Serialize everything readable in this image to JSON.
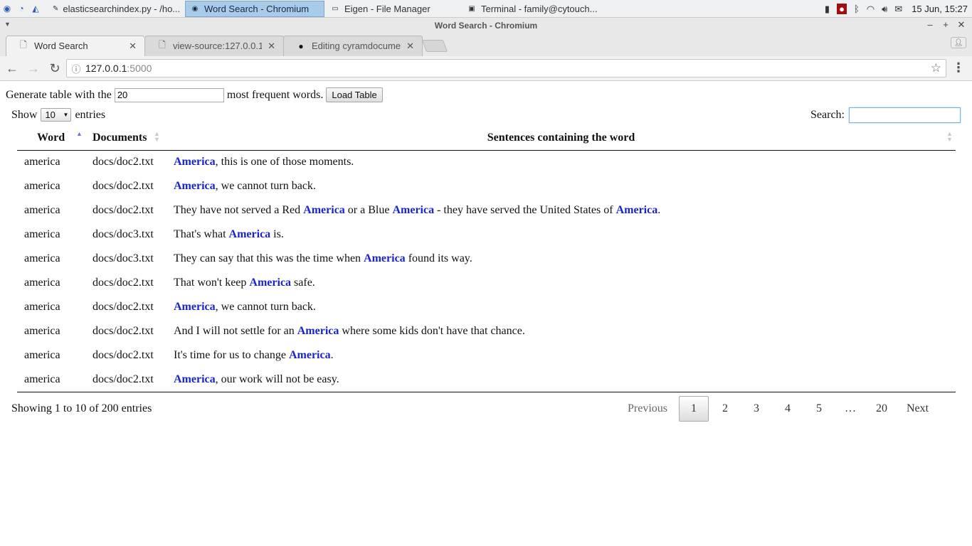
{
  "taskbar": {
    "windows": [
      {
        "label": "elasticsearchindex.py - /ho...",
        "icon": "python-file-icon",
        "active": false
      },
      {
        "label": "Word Search - Chromium",
        "icon": "chromium-icon",
        "active": true
      },
      {
        "label": "Eigen - File Manager",
        "icon": "folder-icon",
        "active": false
      },
      {
        "label": "Terminal - family@cytouch...",
        "icon": "terminal-icon",
        "active": false
      }
    ],
    "clock": "15 Jun, 15:27"
  },
  "browser": {
    "window_title": "Word Search - Chromium",
    "tabs": [
      {
        "label": "Word Search",
        "icon": "page-icon"
      },
      {
        "label": "view-source:127.0.0.1:5",
        "icon": "page-icon"
      },
      {
        "label": "Editing cyramdocume",
        "icon": "github-icon"
      }
    ],
    "url_host": "127.0.0.1",
    "url_port": ":5000"
  },
  "page": {
    "generate_prefix": "Generate table with the",
    "generate_value": "20",
    "generate_suffix": "most frequent words.",
    "load_button": "Load Table",
    "show_label": "Show",
    "show_value": "10",
    "entries_label": "entries",
    "search_label": "Search:",
    "columns": [
      "Word",
      "Documents",
      "Sentences containing the word"
    ],
    "rows": [
      {
        "word": "america",
        "doc": "docs/doc2.txt",
        "sentence": [
          {
            "t": "America",
            "h": true
          },
          {
            "t": ", this is one of those moments."
          }
        ]
      },
      {
        "word": "america",
        "doc": "docs/doc2.txt",
        "sentence": [
          {
            "t": "America",
            "h": true
          },
          {
            "t": ", we cannot turn back."
          }
        ]
      },
      {
        "word": "america",
        "doc": "docs/doc2.txt",
        "sentence": [
          {
            "t": "They have not served a Red "
          },
          {
            "t": "America",
            "h": true
          },
          {
            "t": " or a Blue "
          },
          {
            "t": "America",
            "h": true
          },
          {
            "t": " - they have served the United States of "
          },
          {
            "t": "America",
            "h": true
          },
          {
            "t": "."
          }
        ]
      },
      {
        "word": "america",
        "doc": "docs/doc3.txt",
        "sentence": [
          {
            "t": "That's what "
          },
          {
            "t": "America",
            "h": true
          },
          {
            "t": " is."
          }
        ]
      },
      {
        "word": "america",
        "doc": "docs/doc3.txt",
        "sentence": [
          {
            "t": "They can say that this was the time when "
          },
          {
            "t": "America",
            "h": true
          },
          {
            "t": " found its way."
          }
        ]
      },
      {
        "word": "america",
        "doc": "docs/doc2.txt",
        "sentence": [
          {
            "t": "That won't keep "
          },
          {
            "t": "America",
            "h": true
          },
          {
            "t": " safe."
          }
        ]
      },
      {
        "word": "america",
        "doc": "docs/doc2.txt",
        "sentence": [
          {
            "t": "America",
            "h": true
          },
          {
            "t": ", we cannot turn back."
          }
        ]
      },
      {
        "word": "america",
        "doc": "docs/doc2.txt",
        "sentence": [
          {
            "t": "And I will not settle for an "
          },
          {
            "t": "America",
            "h": true
          },
          {
            "t": " where some kids don't have that chance."
          }
        ]
      },
      {
        "word": "america",
        "doc": "docs/doc2.txt",
        "sentence": [
          {
            "t": "It's time for us to change "
          },
          {
            "t": "America",
            "h": true
          },
          {
            "t": "."
          }
        ]
      },
      {
        "word": "america",
        "doc": "docs/doc2.txt",
        "sentence": [
          {
            "t": "America",
            "h": true
          },
          {
            "t": ", our work will not be easy."
          }
        ]
      }
    ],
    "info": "Showing 1 to 10 of 200 entries",
    "pagination": {
      "previous": "Previous",
      "pages": [
        "1",
        "2",
        "3",
        "4",
        "5",
        "…",
        "20"
      ],
      "current": "1",
      "next": "Next"
    }
  },
  "colors": {
    "highlight": "#1a24c8",
    "sort_active": "#6b78d8",
    "taskbar_active": "#a9cbea"
  }
}
